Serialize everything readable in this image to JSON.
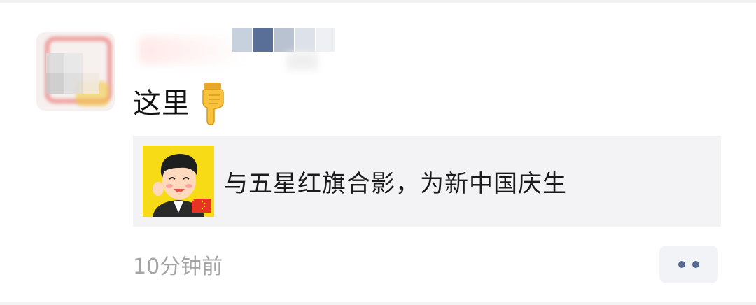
{
  "post": {
    "text": "这里",
    "text_icon": "pointing-down-hand-icon",
    "author_name_visible": false,
    "avatar_visible": false
  },
  "link_card": {
    "title": "与五星红旗合影，为新中国庆生",
    "thumbnail_icon": "cartoon-man-with-china-flag-icon"
  },
  "footer": {
    "timestamp": "10分钟前",
    "more_icon": "more-dots-icon"
  },
  "colors": {
    "card_background": "#f3f3f5",
    "timestamp_text": "#a4a4a4",
    "more_dots": "#566a92",
    "thumbnail_background": "#f6db16"
  }
}
